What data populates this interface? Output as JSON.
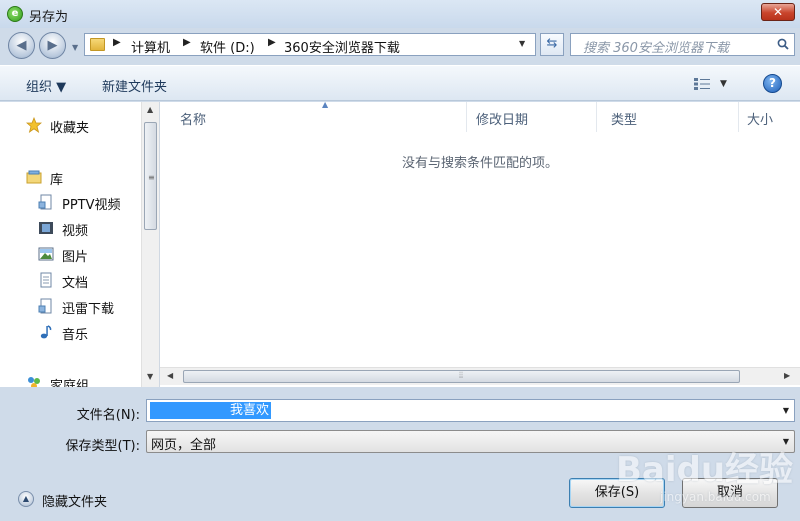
{
  "window": {
    "title": "另存为",
    "close_label": "✕"
  },
  "address_bar": {
    "crumbs": [
      "计算机",
      "软件 (D:)",
      "360安全浏览器下载"
    ]
  },
  "search": {
    "placeholder": "搜索 360安全浏览器下载"
  },
  "toolbar": {
    "organize_label": "组织 ▼",
    "new_folder_label": "新建文件夹"
  },
  "nav_pane": {
    "favorites_label": "收藏夹",
    "libraries_label": "库",
    "library_items": [
      "PPTV视频",
      "视频",
      "图片",
      "文档",
      "迅雷下载",
      "音乐"
    ],
    "homegroup_label": "家庭组"
  },
  "file_list": {
    "columns": [
      "名称",
      "修改日期",
      "类型",
      "大小"
    ],
    "empty_message": "没有与搜索条件匹配的项。"
  },
  "form": {
    "filename_label": "文件名(N):",
    "filename_value": "我喜欢",
    "filetype_label": "保存类型(T):",
    "filetype_value": "网页，全部"
  },
  "footer": {
    "hide_folders_label": "隐藏文件夹",
    "save_label": "保存(S)",
    "cancel_label": "取消"
  },
  "watermark": {
    "brand": "Baidu经验",
    "url": "jingyan.baidu.com"
  },
  "colors": {
    "selection": "#3399ff",
    "close_button": "#c9452c",
    "window_frame": "#cfdbe9"
  }
}
